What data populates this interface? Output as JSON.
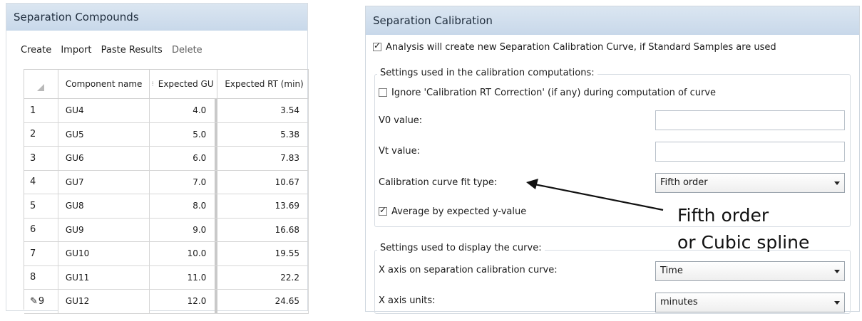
{
  "left": {
    "title": "Separation Compounds",
    "toolbar": {
      "create": "Create",
      "import": "Import",
      "paste": "Paste Results",
      "delete": "Delete"
    },
    "columns": {
      "name": "Component name",
      "gu": "Expected GU",
      "rt": "Expected RT (min)"
    },
    "rows": [
      {
        "idx": "1",
        "name": "GU4",
        "gu": "4.0",
        "rt": "3.54"
      },
      {
        "idx": "2",
        "name": "GU5",
        "gu": "5.0",
        "rt": "5.38"
      },
      {
        "idx": "3",
        "name": "GU6",
        "gu": "6.0",
        "rt": "7.83"
      },
      {
        "idx": "4",
        "name": "GU7",
        "gu": "7.0",
        "rt": "10.67"
      },
      {
        "idx": "5",
        "name": "GU8",
        "gu": "8.0",
        "rt": "13.69"
      },
      {
        "idx": "6",
        "name": "GU9",
        "gu": "9.0",
        "rt": "16.68"
      },
      {
        "idx": "7",
        "name": "GU10",
        "gu": "10.0",
        "rt": "19.55"
      },
      {
        "idx": "8",
        "name": "GU11",
        "gu": "11.0",
        "rt": "22.2"
      },
      {
        "idx": "9",
        "name": "GU12",
        "gu": "12.0",
        "rt": "24.65"
      }
    ]
  },
  "right": {
    "title": "Separation Calibration",
    "analysis_label": "Analysis will create new Separation Calibration Curve, if Standard Samples are used",
    "analysis_checked": true,
    "group1_title": "Settings used in the calibration computations:",
    "ignore_label": "Ignore 'Calibration RT Correction' (if any) during computation of curve",
    "ignore_checked": false,
    "v0_label": "V0 value:",
    "v0_value": "",
    "vt_label": "Vt value:",
    "vt_value": "",
    "fit_label": "Calibration curve fit type:",
    "fit_value": "Fifth order",
    "average_label": "Average by expected y-value",
    "average_checked": true,
    "group2_title": "Settings used to display the curve:",
    "xaxis_label": "X axis on separation calibration curve:",
    "xaxis_value": "Time",
    "xunits_label": "X axis units:",
    "xunits_value": "minutes"
  },
  "annotation": {
    "line1": "Fifth order",
    "line2": "or Cubic spline"
  },
  "icons": {
    "edit_row": "pencil-icon",
    "dropdown": "chevron-down-icon"
  }
}
